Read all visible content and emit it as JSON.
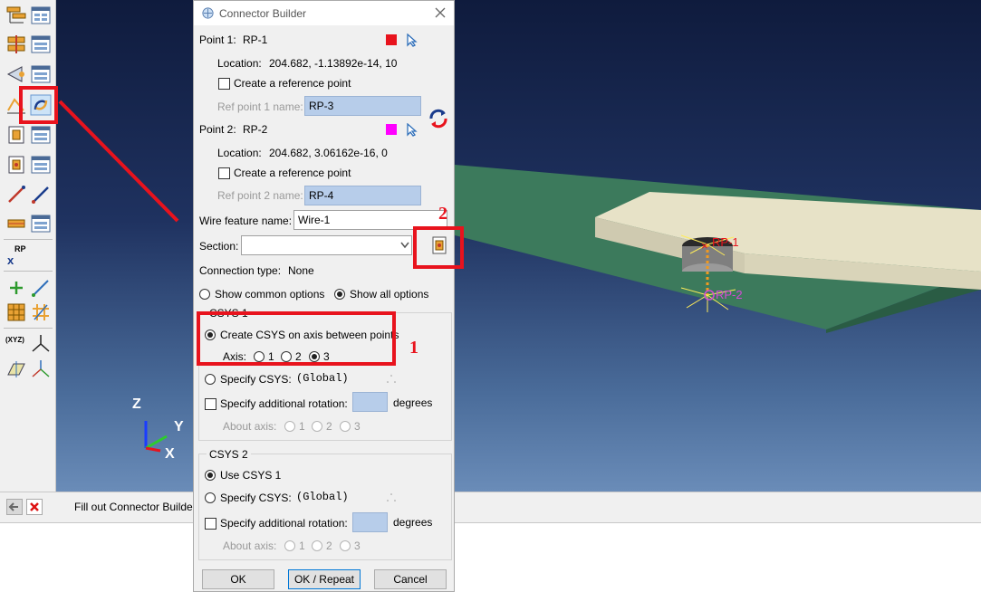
{
  "dialog": {
    "title": "Connector Builder",
    "point1": {
      "label": "Point 1:",
      "value": "RP-1",
      "color": "#e8131d",
      "location_label": "Location:",
      "location": "204.682, -1.13892e-14, 10",
      "create_ref": "Create a reference point",
      "ref_name_label": "Ref point 1 name:",
      "ref_name": "RP-3"
    },
    "point2": {
      "label": "Point 2:",
      "value": "RP-2",
      "color": "#ff00ff",
      "location_label": "Location:",
      "location": "204.682, 3.06162e-16, 0",
      "create_ref": "Create a reference point",
      "ref_name_label": "Ref point 2 name:",
      "ref_name": "RP-4"
    },
    "wire_label": "Wire feature name:",
    "wire_name": "Wire-1",
    "section_label": "Section:",
    "section_value": "",
    "connection_type_label": "Connection type:",
    "connection_type": "None",
    "show_common": "Show common options",
    "show_all": "Show all options",
    "csys1": {
      "title": "CSYS 1",
      "create_on_axis": "Create CSYS on axis between points",
      "axis_label": "Axis:",
      "axis_options": [
        "1",
        "2",
        "3"
      ],
      "axis_selected": "3",
      "specify_csys": "Specify CSYS:",
      "csys_value": "(Global)",
      "additional_rotation": "Specify additional rotation:",
      "degrees": "degrees",
      "about_axis": "About axis:",
      "about_options": [
        "1",
        "2",
        "3"
      ]
    },
    "csys2": {
      "title": "CSYS 2",
      "use_csys1": "Use CSYS 1",
      "specify_csys": "Specify CSYS:",
      "csys_value": "(Global)",
      "additional_rotation": "Specify additional rotation:",
      "degrees": "degrees",
      "about_axis": "About axis:",
      "about_options": [
        "1",
        "2",
        "3"
      ]
    },
    "buttons": {
      "ok": "OK",
      "ok_repeat": "OK / Repeat",
      "cancel": "Cancel"
    }
  },
  "prompt": {
    "text": "Fill out Connector Builder dialog"
  },
  "toolbox": {
    "rp_label": "RP",
    "xyz_label": "(XYZ)"
  },
  "viewport": {
    "rp1_label": "RP-1",
    "rp2_label": "RP-2",
    "triad": {
      "z": "Z",
      "y": "Y",
      "x": "X"
    }
  },
  "annotations": {
    "one": "1",
    "two": "2"
  }
}
